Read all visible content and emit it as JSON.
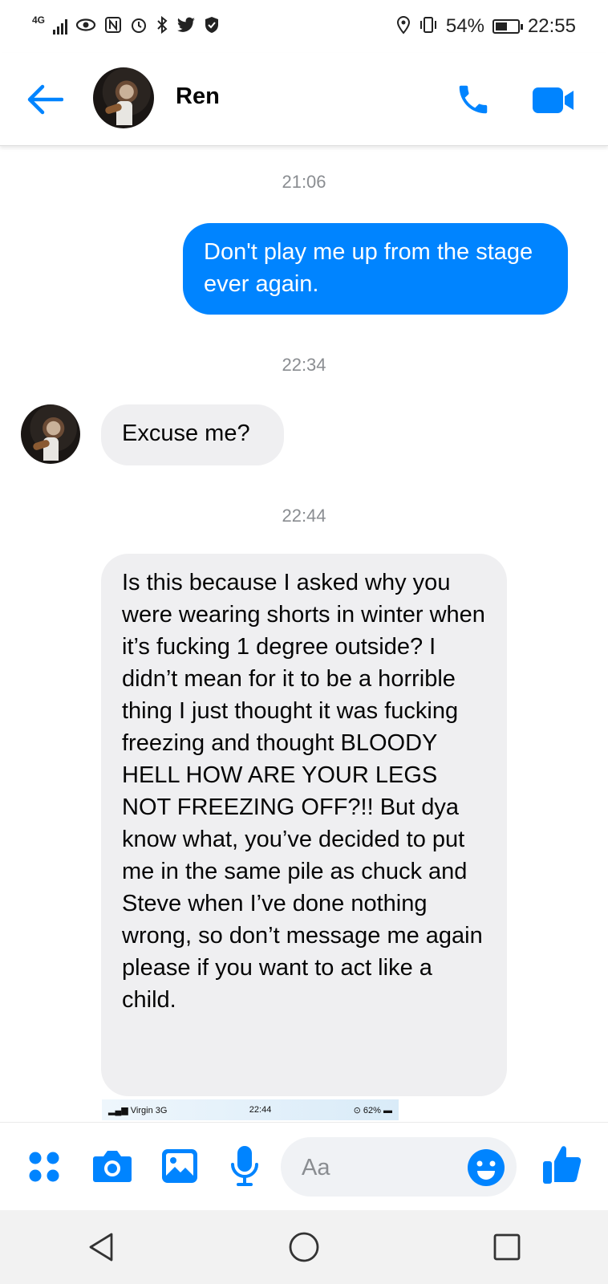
{
  "status_bar": {
    "network": "4G",
    "battery": "54%",
    "battery_level": 0.54,
    "time": "22:55",
    "icons": [
      "signal-icon",
      "eye-icon",
      "nfc-icon",
      "alarm-icon",
      "bluetooth-icon",
      "twitter-icon",
      "shield-icon",
      "location-icon",
      "vibrate-icon",
      "battery-icon"
    ]
  },
  "header": {
    "contact_name": "Ren"
  },
  "conversation": {
    "timestamps": [
      "21:06",
      "22:34",
      "22:44"
    ],
    "messages": [
      {
        "direction": "outgoing",
        "text": "Don't play me up from the stage ever again."
      },
      {
        "direction": "incoming",
        "text": "Excuse me?"
      },
      {
        "direction": "incoming",
        "text": "Is this because I asked why you were wearing shorts in winter when it’s fucking 1 degree outside? I didn’t mean for it to be a horrible thing I just thought it was fucking freezing and thought BLOODY HELL HOW ARE YOUR LEGS NOT FREEZING OFF?!! But dya know what, you’ve decided to put me in the same pile as chuck and Steve when I’ve done nothing wrong, so don’t message me again please if you want to act like a child."
      }
    ]
  },
  "image_preview": {
    "carrier": "Virgin",
    "network": "3G",
    "time": "22:44",
    "battery": "62%"
  },
  "composer": {
    "placeholder": "Aa"
  },
  "colors": {
    "accent": "#0084ff",
    "incoming_bubble": "#efeff1",
    "timestamp": "#8a8d91"
  }
}
